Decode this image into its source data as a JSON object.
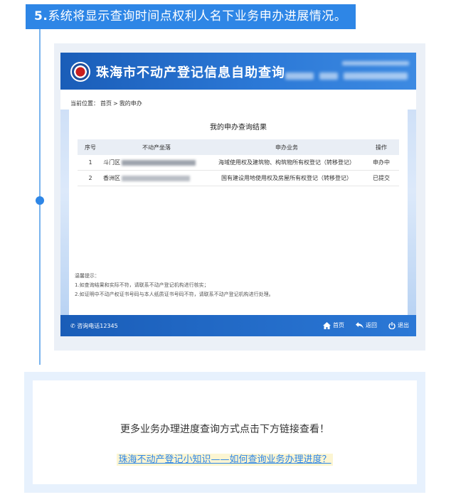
{
  "step": {
    "number": "5",
    "title": "系统将显示查询时间点权利人名下业务申办进展情况。"
  },
  "app": {
    "title": "珠海市不动产登记信息自助查询",
    "breadcrumb": {
      "prefix": "当前位置：",
      "home": "首页",
      "sep": ">",
      "current": "我的申办"
    },
    "results_title": "我的申办查询结果",
    "table": {
      "headers": {
        "no": "序号",
        "location": "不动产坐落",
        "business": "申办业务",
        "action": "操作"
      },
      "rows": [
        {
          "no": "1",
          "district": "斗门区",
          "business": "海域使用权及建筑物、构筑物所有权登记（转移登记）",
          "status": "申办中"
        },
        {
          "no": "2",
          "district": "香洲区",
          "business": "国有建设用地使用权及房屋所有权登记（转移登记）",
          "status": "已提交"
        }
      ]
    },
    "tips": {
      "heading": "温馨提示：",
      "line1": "1.如查询结果和实际不符，请联系不动产登记机构进行核实；",
      "line2": "2.如证明中不动产权证书号码与本人纸质证书号码不符，请联系不动产登记机构进行处理。"
    },
    "footer": {
      "phone": "✆ 咨询电话12345",
      "home": "首页",
      "back": "返回",
      "exit": "退出"
    }
  },
  "bottom": {
    "text": "更多业务办理进度查询方式点击下方链接查看！",
    "link": "珠海不动产登记小知识——如何查询业务办理进度？"
  },
  "colors": {
    "accent": "#2e86e6",
    "header_blue": "#1a5db8",
    "link_highlight": "#fcf5d2"
  }
}
